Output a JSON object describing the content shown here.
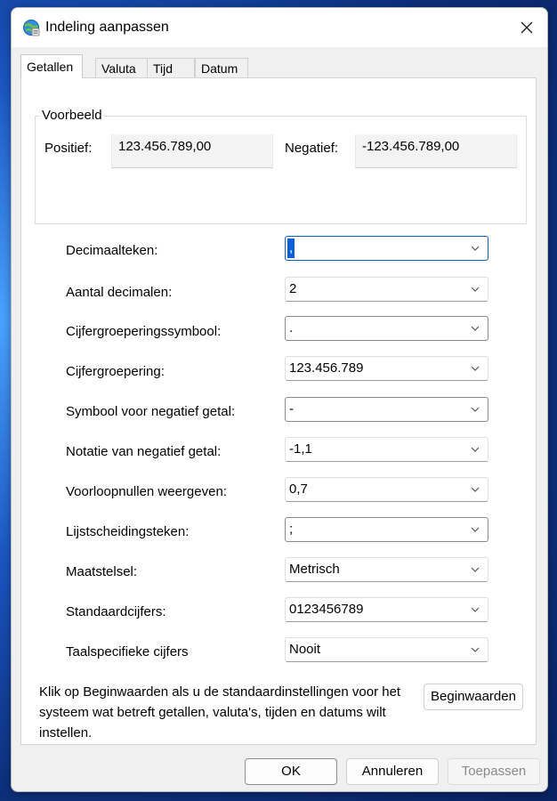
{
  "window": {
    "title": "Indeling aanpassen"
  },
  "tabs": [
    {
      "label": "Getallen",
      "active": true
    },
    {
      "label": "Valuta",
      "active": false
    },
    {
      "label": "Tijd",
      "active": false
    },
    {
      "label": "Datum",
      "active": false
    }
  ],
  "preview": {
    "group_label": "Voorbeeld",
    "positive_label": "Positief:",
    "positive_value": "123.456.789,00",
    "negative_label": "Negatief:",
    "negative_value": "-123.456.789,00"
  },
  "settings": [
    {
      "label": "Decimaalteken:",
      "value": ","
    },
    {
      "label": "Aantal decimalen:",
      "value": "2"
    },
    {
      "label": "Cijfergroeperingssymbool:",
      "value": "."
    },
    {
      "label": "Cijfergroepering:",
      "value": "123.456.789"
    },
    {
      "label": "Symbool voor negatief getal:",
      "value": "-"
    },
    {
      "label": "Notatie van negatief getal:",
      "value": "-1,1"
    },
    {
      "label": "Voorloopnullen weergeven:",
      "value": "0,7"
    },
    {
      "label": "Lijstscheidingsteken:",
      "value": ";"
    },
    {
      "label": "Maatstelsel:",
      "value": "Metrisch"
    },
    {
      "label": "Standaardcijfers:",
      "value": "0123456789"
    },
    {
      "label": "Taalspecifieke cijfers",
      "value": "Nooit"
    }
  ],
  "info_text": "Klik op Beginwaarden als u de standaardinstellingen voor het systeem wat betreft getallen, valuta's, tijden en datums wilt instellen.",
  "buttons": {
    "reset": "Beginwaarden",
    "ok": "OK",
    "cancel": "Annuleren",
    "apply": "Toepassen"
  },
  "colors": {
    "accent": "#0b5fd6",
    "dialog_bg": "#f0f0f0"
  },
  "icons": {
    "app": "globe-settings-icon",
    "close": "close-icon",
    "dropdown": "chevron-down-icon"
  }
}
